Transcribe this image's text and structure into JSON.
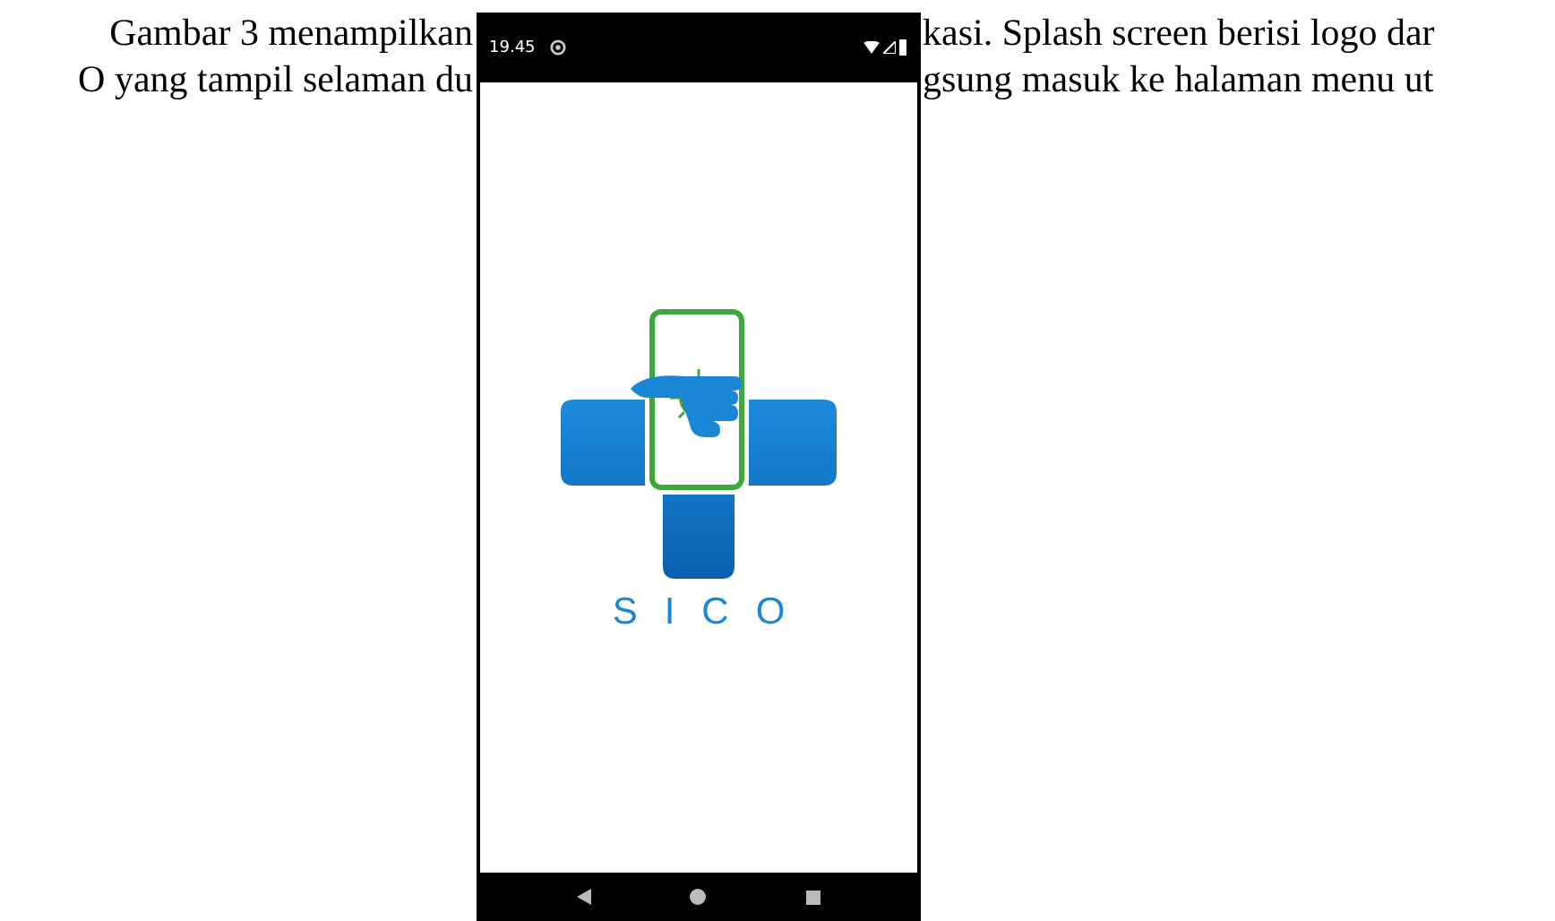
{
  "document": {
    "lines": [
      {
        "left": "Gambar 3 menampilkan",
        "right": "kasi. Splash screen berisi logo dar"
      },
      {
        "left": "O yang tampil selaman du",
        "right": "gsung masuk ke halaman menu ut"
      }
    ]
  },
  "phone": {
    "status_bar": {
      "time": "19.45"
    },
    "splash": {
      "app_name": "SICO"
    }
  }
}
